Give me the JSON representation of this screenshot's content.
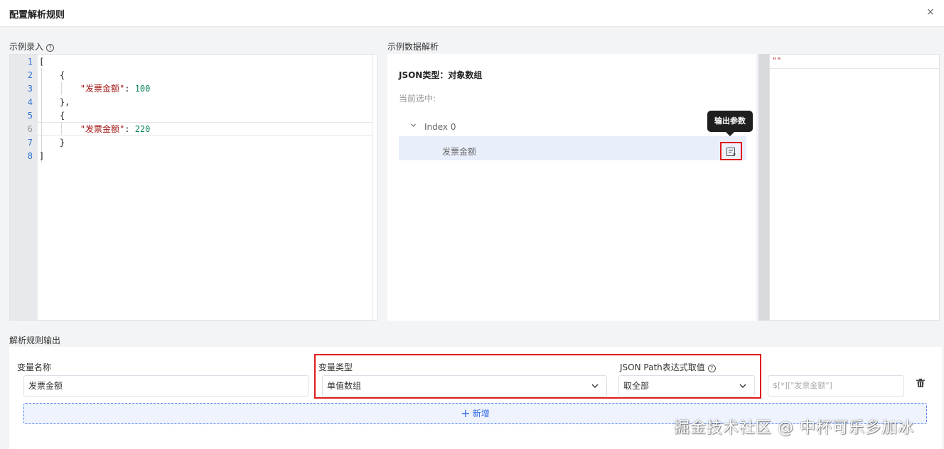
{
  "dialog": {
    "title": "配置解析规则",
    "close_icon": "×"
  },
  "sample_input": {
    "label": "示例录入",
    "help_icon": "?",
    "line_numbers": [
      "1",
      "2",
      "3",
      "4",
      "5",
      "6",
      "7",
      "8"
    ],
    "lines": [
      {
        "pre": "[",
        "key": "",
        "sep": "",
        "num": ""
      },
      {
        "pre": "    {",
        "key": "",
        "sep": "",
        "num": ""
      },
      {
        "pre": "        ",
        "key": "\"发票金额\"",
        "sep": ": ",
        "num": "100"
      },
      {
        "pre": "    },",
        "key": "",
        "sep": "",
        "num": ""
      },
      {
        "pre": "    {",
        "key": "",
        "sep": "",
        "num": ""
      },
      {
        "pre": "        ",
        "key": "\"发票金额\"",
        "sep": ": ",
        "num": "220"
      },
      {
        "pre": "    }",
        "key": "",
        "sep": "",
        "num": ""
      },
      {
        "pre": "]",
        "key": "",
        "sep": "",
        "num": ""
      }
    ]
  },
  "parse": {
    "label": "示例数据解析",
    "json_type": "JSON类型：对象数组",
    "current_selected": "当前选中:",
    "tree": {
      "node_label": "Index 0",
      "child_label": "发票金额",
      "action_tooltip": "输出参数",
      "action_icon": "output-param-icon"
    },
    "result_text": "\"\""
  },
  "rules": {
    "label": "解析规则输出",
    "var_name": {
      "label": "变量名称",
      "value": "发票金额"
    },
    "var_type": {
      "label": "变量类型",
      "value": "单值数组"
    },
    "json_path": {
      "label": "JSON Path表达式取值",
      "help_icon": "?",
      "value": "取全部"
    },
    "expression_value": "$[*][\"发票金额\"]",
    "add_button": {
      "icon": "+",
      "label": "新增"
    }
  },
  "watermark": "掘金技术社区 @ 中杯可乐多加冰",
  "colors": {
    "highlight_red": "#e01b1b",
    "primary_blue": "#2f6ae6",
    "json_key": "#a31515",
    "json_number": "#098658"
  }
}
